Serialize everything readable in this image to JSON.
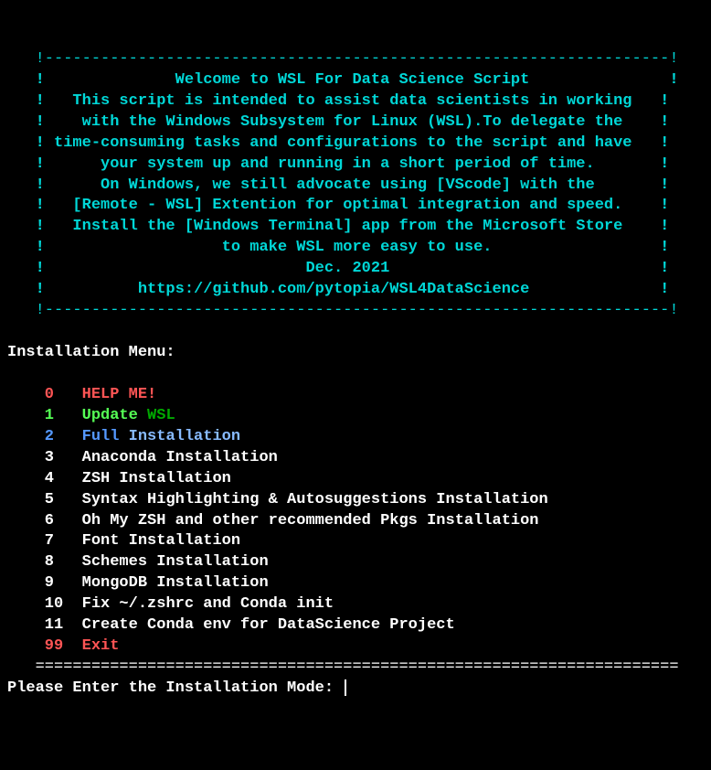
{
  "banner": {
    "border_top": "   !-------------------------------------------------------------------!",
    "line1": "   !              Welcome to WSL For Data Science Script               !",
    "line2": "   !   This script is intended to assist data scientists in working   !",
    "line3": "   !    with the Windows Subsystem for Linux (WSL).To delegate the    !",
    "line4": "   ! time-consuming tasks and configurations to the script and have   !",
    "line5": "   !      your system up and running in a short period of time.       !",
    "line6": "   !      On Windows, we still advocate using [VScode] with the       !",
    "line7": "   !   [Remote - WSL] Extention for optimal integration and speed.    !",
    "line8": "   !   Install the [Windows Terminal] app from the Microsoft Store    !",
    "line9": "   !                   to make WSL more easy to use.                  !",
    "line10": "   !                            Dec. 2021                             !",
    "line11": "   !          https://github.com/pytopia/WSL4DataScience              !",
    "border_bottom": "   !-------------------------------------------------------------------!"
  },
  "menu": {
    "title": "Installation Menu:",
    "items": {
      "n0": "    0   ",
      "l0": "HELP ME!",
      "n1": "    1   ",
      "l1a": "Update ",
      "l1b": "WSL",
      "n2": "    2   ",
      "l2a": "Full ",
      "l2b": "Installation",
      "n3": "    3   ",
      "l3": "Anaconda Installation",
      "n4": "    4   ",
      "l4": "ZSH Installation",
      "n5": "    5   ",
      "l5": "Syntax Highlighting & Autosuggestions Installation",
      "n6": "    6   ",
      "l6": "Oh My ZSH and other recommended Pkgs Installation",
      "n7": "    7   ",
      "l7": "Font Installation",
      "n8": "    8   ",
      "l8": "Schemes Installation",
      "n9": "    9   ",
      "l9": "MongoDB Installation",
      "n10": "    10  ",
      "l10": "Fix ~/.zshrc and Conda init",
      "n11": "    11  ",
      "l11": "Create Conda env for DataScience Project",
      "n99": "    99  ",
      "l99": "Exit"
    },
    "separator": "   =====================================================================",
    "prompt": "Please Enter the Installation Mode: "
  }
}
